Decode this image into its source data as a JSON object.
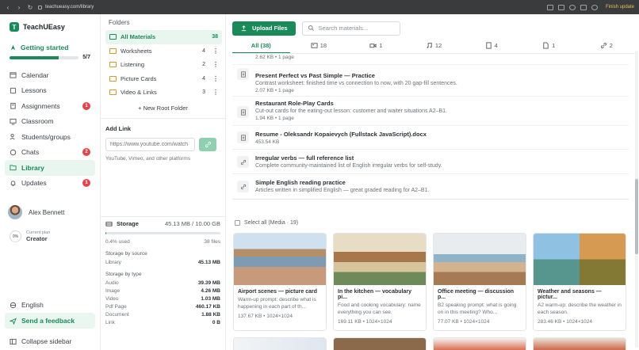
{
  "browser": {
    "url": "teachueasy.com/library",
    "finish_label": "Finish update"
  },
  "sidebar": {
    "brand": "TeachUEasy",
    "getting_started": {
      "label": "Getting started",
      "count": "5/7",
      "progress": 0.71
    },
    "items": [
      {
        "label": "Calendar",
        "badge": "",
        "icon": "calendar-icon"
      },
      {
        "label": "Lessons",
        "badge": "",
        "icon": "book-icon"
      },
      {
        "label": "Assignments",
        "badge": "1",
        "icon": "clipboard-icon"
      },
      {
        "label": "Classroom",
        "badge": "",
        "icon": "monitor-icon"
      },
      {
        "label": "Students/groups",
        "badge": "",
        "icon": "users-icon"
      },
      {
        "label": "Chats",
        "badge": "2",
        "icon": "chat-icon"
      },
      {
        "label": "Library",
        "badge": "",
        "icon": "library-icon",
        "active": true
      },
      {
        "label": "Updates",
        "badge": "1",
        "icon": "bell-icon"
      }
    ],
    "user": {
      "name": "Alex Bennett"
    },
    "plan": {
      "percent": "0%",
      "caption": "Current plan",
      "name": "Creator"
    },
    "footer": {
      "language": "English",
      "feedback": "Send a feedback",
      "collapse": "Collapse sidebar"
    }
  },
  "folders": {
    "heading": "Folders",
    "items": [
      {
        "label": "All Materials",
        "count": "38",
        "active": true
      },
      {
        "label": "Worksheets",
        "count": "4"
      },
      {
        "label": "Listening",
        "count": "2"
      },
      {
        "label": "Picture Cards",
        "count": "4"
      },
      {
        "label": "Video & Links",
        "count": "3"
      }
    ],
    "new_root": "+ New Root Folder",
    "add_link": {
      "heading": "Add Link",
      "placeholder": "https://www.youtube.com/watch",
      "hint": "YouTube, Vimeo, and other platforms"
    }
  },
  "storage": {
    "label": "Storage",
    "value": "45.13 MB / 10.00 GB",
    "used": "0.4% used",
    "files": "38 files",
    "fraction": 0.004,
    "by_source_heading": "Storage by source",
    "by_source": [
      {
        "label": "Library",
        "value": "45.13 MB"
      }
    ],
    "by_type_heading": "Storage by type",
    "by_type": [
      {
        "label": "Audio",
        "value": "39.39 MB"
      },
      {
        "label": "Image",
        "value": "4.26 MB"
      },
      {
        "label": "Video",
        "value": "1.03 MB"
      },
      {
        "label": "Pdf Page",
        "value": "460.17 KB"
      },
      {
        "label": "Document",
        "value": "1.88 KB"
      },
      {
        "label": "Link",
        "value": "0 B"
      }
    ]
  },
  "main": {
    "upload_label": "Upload Files",
    "search_placeholder": "Search materials...",
    "tabs": [
      {
        "label": "All (38)",
        "active": true,
        "icon": ""
      },
      {
        "label": "18",
        "icon": "image-icon"
      },
      {
        "label": "1",
        "icon": "video-icon"
      },
      {
        "label": "12",
        "icon": "music-icon"
      },
      {
        "label": "4",
        "icon": "document-icon"
      },
      {
        "label": "1",
        "icon": "file-icon"
      },
      {
        "label": "2",
        "icon": "link-icon"
      }
    ],
    "list_top_meta": "2.62 KB • 1 page",
    "list": [
      {
        "title": "Present Perfect vs Past Simple — Practice",
        "desc": "Contrast worksheet: finished time vs connection to now, with 20 gap-fill sentences.",
        "meta": "2.07 KB • 1 page",
        "icon": "document-icon"
      },
      {
        "title": "Restaurant Role-Play Cards",
        "desc": "Cut-out cards for the eating-out lesson: customer and waiter situations A2–B1.",
        "meta": "1.94 KB • 1 page",
        "icon": "document-icon"
      },
      {
        "title": "Resume - Oleksandr Kopaievych (Fullstack JavaScript).docx",
        "desc": "",
        "meta": "453.54 KB",
        "icon": "document-icon"
      },
      {
        "title": "Irregular verbs — full reference list",
        "desc": "Complete community-maintained list of English irregular verbs for self-study.",
        "meta": "",
        "icon": "link-icon"
      },
      {
        "title": "Simple English reading practice",
        "desc": "Articles written in simplified English — great graded reading for A2–B1.",
        "meta": "",
        "icon": "link-icon"
      }
    ],
    "select_all": "Select all (Media · 19)",
    "cards": [
      {
        "title": "Airport scenes — picture card",
        "desc": "Warm-up prompt: describe what is happening in each part of th...",
        "meta": "137.67 KB • 1024×1024"
      },
      {
        "title": "In the kitchen — vocabulary pi...",
        "desc": "Food and cooking vocabulary: name everything you can see.",
        "meta": "169.11 KB • 1024×1024"
      },
      {
        "title": "Office meeting — discussion p...",
        "desc": "B2 speaking prompt: what is going on in this meeting? Who...",
        "meta": "77.07 KB • 1024×1024"
      },
      {
        "title": "Weather and seasons — pictur...",
        "desc": "A2 warm-up: describe the weather in each season.",
        "meta": "283.46 KB • 1024×1024"
      }
    ]
  }
}
